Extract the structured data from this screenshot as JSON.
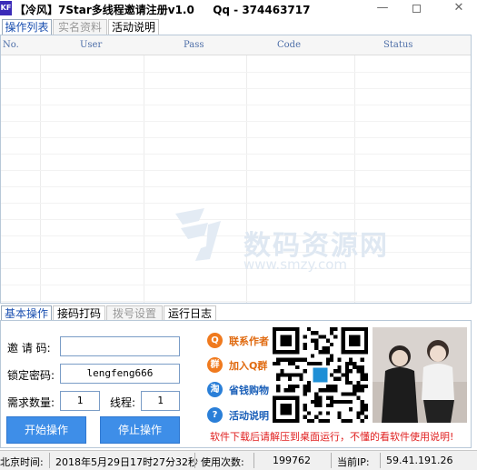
{
  "window": {
    "logo_text": "KF",
    "title": "【冷风】7Star多线程邀请注册v1.0",
    "qq_label": "Qq - 374463717",
    "minimize": "—",
    "close": "✕"
  },
  "top_tabs": [
    {
      "label": "操作列表",
      "state": "active"
    },
    {
      "label": "实名资料",
      "state": "disabled"
    },
    {
      "label": "活动说明",
      "state": "normal"
    }
  ],
  "list": {
    "columns": [
      "No.",
      "User",
      "Pass",
      "Code",
      "Status"
    ]
  },
  "watermark": {
    "text": "数码资源网",
    "url": "www.smzy.com"
  },
  "bottom_tabs": [
    {
      "label": "基本操作",
      "state": "active"
    },
    {
      "label": "接码打码",
      "state": "normal"
    },
    {
      "label": "拨号设置",
      "state": "disabled"
    },
    {
      "label": "运行日志",
      "state": "normal"
    }
  ],
  "form": {
    "invite_code_label": "邀 请 码:",
    "invite_code_value": "",
    "lock_password_label": "锁定密码:",
    "lock_password_value": "lengfeng666",
    "demand_label": "需求数量:",
    "demand_value": "1",
    "threads_label": "线程:",
    "threads_value": "1",
    "start_button": "开始操作",
    "stop_button": "停止操作"
  },
  "promo": [
    {
      "label": "联系作者",
      "icon": "qq-icon",
      "color": "#f07a1e",
      "text_color": "#e06a10",
      "glyph": "Q"
    },
    {
      "label": "加入Q群",
      "icon": "qq-group-icon",
      "color": "#f07a1e",
      "text_color": "#e06a10",
      "glyph": "群"
    },
    {
      "label": "省钱购物",
      "icon": "taobao-icon",
      "color": "#2a7fd8",
      "text_color": "#1a5fb8",
      "glyph": "淘"
    },
    {
      "label": "活动说明",
      "icon": "help-icon",
      "color": "#2a7fd8",
      "text_color": "#1a5fb8",
      "glyph": "?"
    }
  ],
  "notice": "软件下载后请解压到桌面运行，不懂的看软件使用说明!",
  "status": {
    "time_label": "北京时间:",
    "time_value": "2018年5月29日17时27分32秒",
    "uses_label": "使用次数:",
    "uses_value": "199762",
    "ip_label": "当前IP:",
    "ip_value": "59.41.191.26"
  },
  "colors": {
    "accent": "#3e8ee8",
    "tab_active_text": "#1a4fb0",
    "notice_red": "#e02020"
  }
}
